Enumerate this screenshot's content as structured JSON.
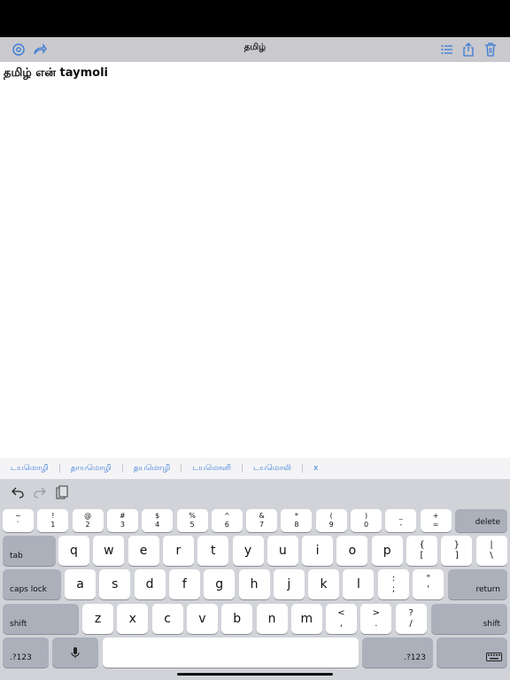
{
  "nav": {
    "title": "தமிழ்",
    "left_icons": [
      "gear-icon",
      "redo-share-icon"
    ],
    "right_icons": [
      "list-icon",
      "share-icon",
      "trash-icon"
    ],
    "accent_color": "#3a7bd5"
  },
  "document": {
    "text": "தமிழ் என் taymoli"
  },
  "suggestions": [
    "டயமொழி",
    "தாயமொழி",
    "தயமொழி",
    "டயமொளி",
    "டயமொலி",
    "x"
  ],
  "keyboard": {
    "toolbar_icons": [
      "undo-icon",
      "redo-icon",
      "paste-icon"
    ],
    "number_row": [
      {
        "top": "~",
        "bottom": "`"
      },
      {
        "top": "!",
        "bottom": "1"
      },
      {
        "top": "@",
        "bottom": "2"
      },
      {
        "top": "#",
        "bottom": "3"
      },
      {
        "top": "$",
        "bottom": "4"
      },
      {
        "top": "%",
        "bottom": "5"
      },
      {
        "top": "^",
        "bottom": "6"
      },
      {
        "top": "&",
        "bottom": "7"
      },
      {
        "top": "*",
        "bottom": "8"
      },
      {
        "top": "(",
        "bottom": "9"
      },
      {
        "top": ")",
        "bottom": "0"
      },
      {
        "top": "_",
        "bottom": "-"
      },
      {
        "top": "+",
        "bottom": "="
      }
    ],
    "delete_label": "delete",
    "tab_label": "tab",
    "row_q": [
      "q",
      "w",
      "e",
      "r",
      "t",
      "y",
      "u",
      "i",
      "o",
      "p"
    ],
    "row_q_pairs": [
      {
        "top": "{",
        "bottom": "["
      },
      {
        "top": "}",
        "bottom": "]"
      },
      {
        "top": "|",
        "bottom": "\\"
      }
    ],
    "caps_label": "caps lock",
    "row_a": [
      "a",
      "s",
      "d",
      "f",
      "g",
      "h",
      "j",
      "k",
      "l"
    ],
    "row_a_pairs": [
      {
        "top": ":",
        "bottom": ";"
      },
      {
        "top": "\"",
        "bottom": "'"
      }
    ],
    "return_label": "return",
    "shift_label": "shift",
    "row_z": [
      "z",
      "x",
      "c",
      "v",
      "b",
      "n",
      "m"
    ],
    "row_z_pairs": [
      {
        "top": "<",
        "bottom": ","
      },
      {
        "top": ">",
        "bottom": "."
      },
      {
        "top": "?",
        "bottom": "/"
      }
    ],
    "numbers_label": ".?123",
    "mic_icon": "microphone-icon",
    "hide_icon": "keyboard-hide-icon"
  }
}
